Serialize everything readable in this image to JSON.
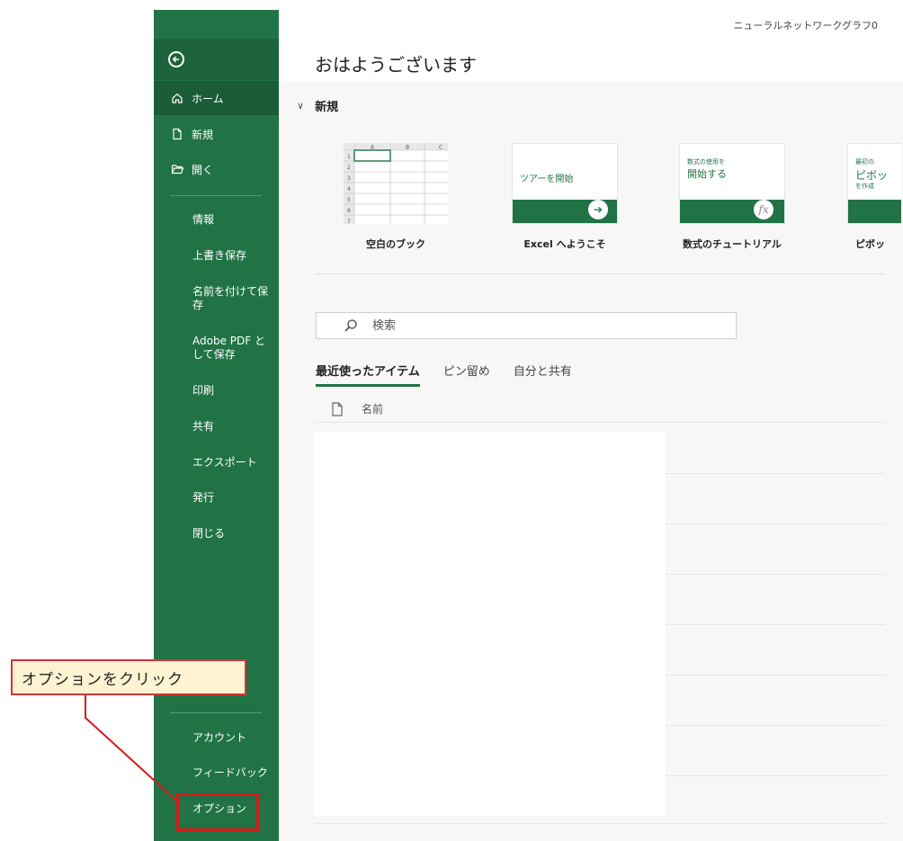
{
  "document": {
    "name": "ニューラルネットワークグラフ0"
  },
  "greeting": "おはようございます",
  "sidebar": {
    "home": "ホーム",
    "new": "新規",
    "open": "開く",
    "info": "情報",
    "save": "上書き保存",
    "save_as": "名前を付けて保存",
    "save_pdf": "Adobe PDF として保存",
    "print": "印刷",
    "share": "共有",
    "export": "エクスポート",
    "publish": "発行",
    "close": "閉じる",
    "account": "アカウント",
    "feedback": "フィードバック",
    "options": "オプション"
  },
  "new_section": {
    "title": "新規",
    "templates": [
      {
        "label": "空白のブック"
      },
      {
        "label": "Excel へようこそ",
        "thumb_text": "ツアーを開始"
      },
      {
        "label": "数式のチュートリアル",
        "thumb_small": "数式の使用を",
        "thumb_text": "開始する",
        "thumb_badge": "fx"
      },
      {
        "label": "ピボッ",
        "thumb_small": "最初の",
        "thumb_text": "ピボッ",
        "thumb_small2": "を作成"
      }
    ],
    "blank_columns": [
      "A",
      "B",
      "C"
    ],
    "blank_rows": [
      "1",
      "2",
      "3",
      "4",
      "5",
      "6",
      "7"
    ]
  },
  "search": {
    "placeholder": "検索"
  },
  "tabs": [
    "最近使ったアイテム",
    "ピン留め",
    "自分と共有"
  ],
  "list": {
    "column_name": "名前"
  },
  "annotation": {
    "callout": "オプションをクリック"
  },
  "colors": {
    "excel_green": "#217346",
    "callout_border": "#d63333",
    "callout_fill": "#fff3d4"
  }
}
